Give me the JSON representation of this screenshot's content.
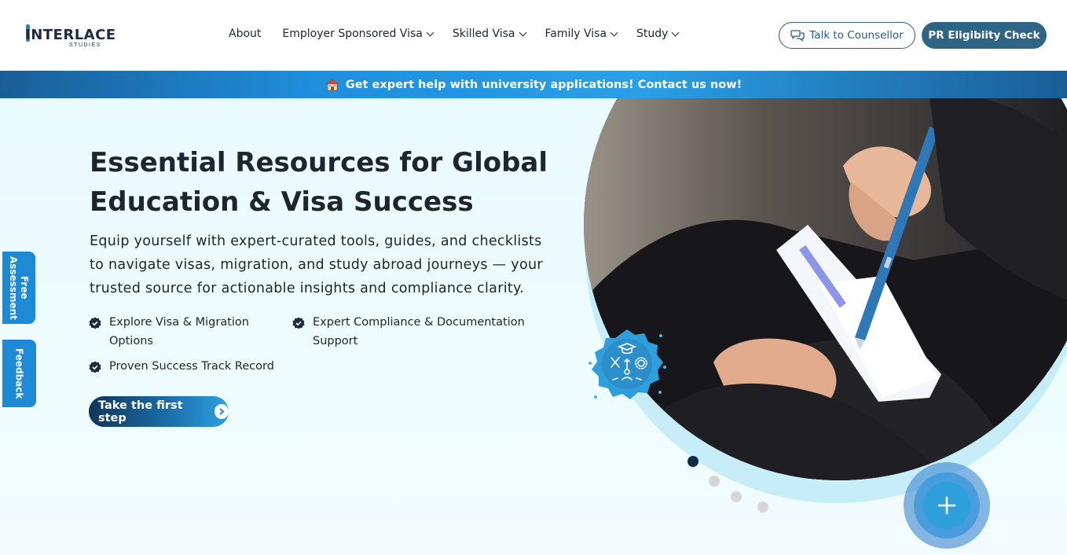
{
  "brand": {
    "name": "INTERLACE",
    "tagline": "STUDIES",
    "accent": "#1e8ad6",
    "primary": "#2e6584"
  },
  "nav": {
    "items": [
      {
        "label": "About",
        "dropdown": false
      },
      {
        "label": "Employer Sponsored Visa",
        "dropdown": true
      },
      {
        "label": "Skilled Visa",
        "dropdown": true
      },
      {
        "label": "Family Visa",
        "dropdown": true
      },
      {
        "label": "Study",
        "dropdown": true
      }
    ]
  },
  "header": {
    "talk_label": "Talk to Counsellor",
    "pr_label": "PR Eligibiity Check"
  },
  "announcement": {
    "icon": "school-icon",
    "text": "Get expert help with university applications! Contact us now!"
  },
  "hero": {
    "title_line1": "Essential Resources for Global",
    "title_line2": "Education & Visa Success",
    "description": "Equip yourself with expert-curated tools, guides, and checklists to navigate visas, migration, and study abroad journeys — your trusted source for actionable insights and compliance clarity.",
    "features": [
      {
        "label": "Explore Visa & Migration Options"
      },
      {
        "label": "Expert Compliance & Documentation Support"
      },
      {
        "label": "Proven Success Track Record"
      }
    ],
    "cta_label": "Take the first step"
  },
  "side_tabs": {
    "assessment_label": "Free Assessment",
    "feedback_label": "Feedback"
  },
  "carousel": {
    "active_index": 0,
    "total": 4
  },
  "floating_action": {
    "icon": "plus-icon"
  }
}
